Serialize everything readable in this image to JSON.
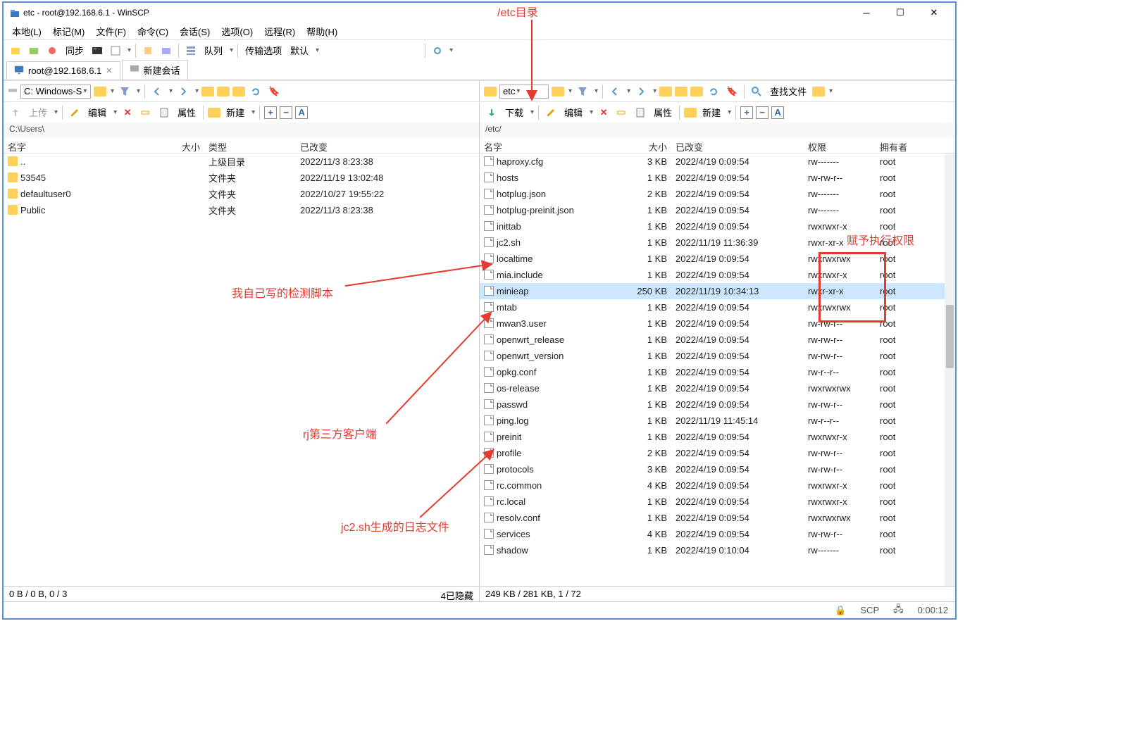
{
  "window": {
    "title": "etc - root@192.168.6.1 - WinSCP"
  },
  "menu": [
    "本地(L)",
    "标记(M)",
    "文件(F)",
    "命令(C)",
    "会话(S)",
    "选项(O)",
    "远程(R)",
    "帮助(H)"
  ],
  "toolbar1": {
    "sync": "同步",
    "queue": "队列",
    "transfer_opts": "传输选项",
    "default": "默认"
  },
  "tabs": [
    {
      "label": "root@192.168.6.1",
      "closable": true
    },
    {
      "label": "新建会话",
      "closable": false
    }
  ],
  "nav": {
    "left_drive": "C: Windows-S",
    "right_drive": "etc",
    "find": "查找文件"
  },
  "edit": {
    "upload": "上传",
    "edit": "编辑",
    "props": "属性",
    "new": "新建",
    "download": "下载"
  },
  "paths": {
    "left": "C:\\Users\\",
    "right": "/etc/"
  },
  "left": {
    "cols": [
      "名字",
      "大小",
      "类型",
      "已改变"
    ],
    "rows": [
      {
        "icon": "up",
        "name": "..",
        "size": "",
        "type": "上级目录",
        "mtime": "2022/11/3  8:23:38"
      },
      {
        "icon": "folder",
        "name": "53545",
        "size": "",
        "type": "文件夹",
        "mtime": "2022/11/19  13:02:48"
      },
      {
        "icon": "folder",
        "name": "defaultuser0",
        "size": "",
        "type": "文件夹",
        "mtime": "2022/10/27  19:55:22"
      },
      {
        "icon": "folder",
        "name": "Public",
        "size": "",
        "type": "文件夹",
        "mtime": "2022/11/3  8:23:38"
      }
    ]
  },
  "right": {
    "cols": [
      "名字",
      "大小",
      "已改变",
      "权限",
      "拥有者"
    ],
    "rows": [
      {
        "name": "haproxy.cfg",
        "size": "3 KB",
        "mtime": "2022/4/19 0:09:54",
        "perm": "rw-------",
        "owner": "root"
      },
      {
        "name": "hosts",
        "size": "1 KB",
        "mtime": "2022/4/19 0:09:54",
        "perm": "rw-rw-r--",
        "owner": "root"
      },
      {
        "name": "hotplug.json",
        "size": "2 KB",
        "mtime": "2022/4/19 0:09:54",
        "perm": "rw-------",
        "owner": "root"
      },
      {
        "name": "hotplug-preinit.json",
        "size": "1 KB",
        "mtime": "2022/4/19 0:09:54",
        "perm": "rw-------",
        "owner": "root"
      },
      {
        "name": "inittab",
        "size": "1 KB",
        "mtime": "2022/4/19 0:09:54",
        "perm": "rwxrwxr-x",
        "owner": "root"
      },
      {
        "name": "jc2.sh",
        "size": "1 KB",
        "mtime": "2022/11/19 11:36:39",
        "perm": "rwxr-xr-x",
        "owner": "root"
      },
      {
        "name": "localtime",
        "size": "1 KB",
        "mtime": "2022/4/19 0:09:54",
        "perm": "rwxrwxrwx",
        "owner": "root"
      },
      {
        "name": "mia.include",
        "size": "1 KB",
        "mtime": "2022/4/19 0:09:54",
        "perm": "rwxrwxr-x",
        "owner": "root"
      },
      {
        "name": "minieap",
        "size": "250 KB",
        "mtime": "2022/11/19 10:34:13",
        "perm": "rwxr-xr-x",
        "owner": "root",
        "sel": true
      },
      {
        "name": "mtab",
        "size": "1 KB",
        "mtime": "2022/4/19 0:09:54",
        "perm": "rwxrwxrwx",
        "owner": "root"
      },
      {
        "name": "mwan3.user",
        "size": "1 KB",
        "mtime": "2022/4/19 0:09:54",
        "perm": "rw-rw-r--",
        "owner": "root"
      },
      {
        "name": "openwrt_release",
        "size": "1 KB",
        "mtime": "2022/4/19 0:09:54",
        "perm": "rw-rw-r--",
        "owner": "root"
      },
      {
        "name": "openwrt_version",
        "size": "1 KB",
        "mtime": "2022/4/19 0:09:54",
        "perm": "rw-rw-r--",
        "owner": "root"
      },
      {
        "name": "opkg.conf",
        "size": "1 KB",
        "mtime": "2022/4/19 0:09:54",
        "perm": "rw-r--r--",
        "owner": "root"
      },
      {
        "name": "os-release",
        "size": "1 KB",
        "mtime": "2022/4/19 0:09:54",
        "perm": "rwxrwxrwx",
        "owner": "root"
      },
      {
        "name": "passwd",
        "size": "1 KB",
        "mtime": "2022/4/19 0:09:54",
        "perm": "rw-rw-r--",
        "owner": "root"
      },
      {
        "name": "ping.log",
        "size": "1 KB",
        "mtime": "2022/11/19 11:45:14",
        "perm": "rw-r--r--",
        "owner": "root"
      },
      {
        "name": "preinit",
        "size": "1 KB",
        "mtime": "2022/4/19 0:09:54",
        "perm": "rwxrwxr-x",
        "owner": "root"
      },
      {
        "name": "profile",
        "size": "2 KB",
        "mtime": "2022/4/19 0:09:54",
        "perm": "rw-rw-r--",
        "owner": "root"
      },
      {
        "name": "protocols",
        "size": "3 KB",
        "mtime": "2022/4/19 0:09:54",
        "perm": "rw-rw-r--",
        "owner": "root"
      },
      {
        "name": "rc.common",
        "size": "4 KB",
        "mtime": "2022/4/19 0:09:54",
        "perm": "rwxrwxr-x",
        "owner": "root"
      },
      {
        "name": "rc.local",
        "size": "1 KB",
        "mtime": "2022/4/19 0:09:54",
        "perm": "rwxrwxr-x",
        "owner": "root"
      },
      {
        "name": "resolv.conf",
        "size": "1 KB",
        "mtime": "2022/4/19 0:09:54",
        "perm": "rwxrwxrwx",
        "owner": "root"
      },
      {
        "name": "services",
        "size": "4 KB",
        "mtime": "2022/4/19 0:09:54",
        "perm": "rw-rw-r--",
        "owner": "root"
      },
      {
        "name": "shadow",
        "size": "1 KB",
        "mtime": "2022/4/19 0:10:04",
        "perm": "rw-------",
        "owner": "root"
      }
    ]
  },
  "status": {
    "left": "0 B / 0 B,   0 / 3",
    "left_hidden": "4已隐藏",
    "right": "249 KB / 281 KB,   1 / 72"
  },
  "footer": {
    "proto": "SCP",
    "time": "0:00:12"
  },
  "annotations": {
    "etc_dir": "/etc目录",
    "my_script": "我自己写的检测脚本",
    "rj_client": "rj第三方客户端",
    "log_file": "jc2.sh生成的日志文件",
    "exec_perm": "赋予执行权限"
  }
}
